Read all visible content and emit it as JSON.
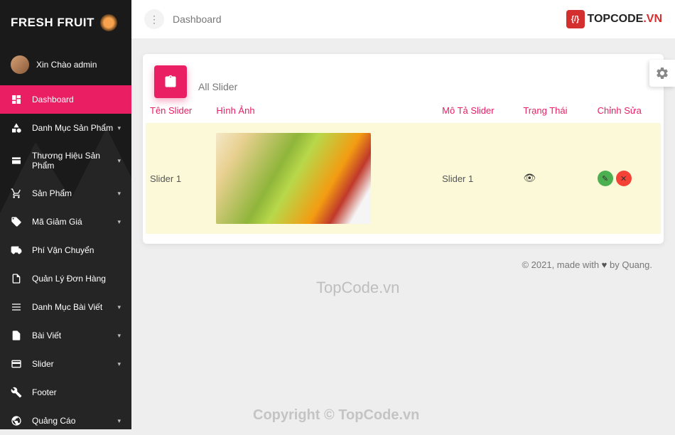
{
  "brand": {
    "name": "FRESH FRUIT",
    "watermark_site": "TOPCODE",
    "watermark_tld": ".VN"
  },
  "user": {
    "greeting": "Xin Chào admin"
  },
  "nav": [
    {
      "label": "Dashboard",
      "icon": "dashboard",
      "active": true,
      "caret": false
    },
    {
      "label": "Danh Mục Sản Phẩm",
      "icon": "category",
      "active": false,
      "caret": true
    },
    {
      "label": "Thương Hiệu Sản Phẩm",
      "icon": "brand",
      "active": false,
      "caret": true
    },
    {
      "label": "Sản Phẩm",
      "icon": "cart",
      "active": false,
      "caret": true
    },
    {
      "label": "Mã Giảm Giá",
      "icon": "tag",
      "active": false,
      "caret": true
    },
    {
      "label": "Phí Vận Chuyển",
      "icon": "truck",
      "active": false,
      "caret": false
    },
    {
      "label": "Quản Lý Đơn Hàng",
      "icon": "order",
      "active": false,
      "caret": false
    },
    {
      "label": "Danh Mục Bài Viết",
      "icon": "list",
      "active": false,
      "caret": true
    },
    {
      "label": "Bài Viết",
      "icon": "post",
      "active": false,
      "caret": true
    },
    {
      "label": "Slider",
      "icon": "card",
      "active": false,
      "caret": true
    },
    {
      "label": "Footer",
      "icon": "wrench",
      "active": false,
      "caret": false
    },
    {
      "label": "Quảng Cáo",
      "icon": "ad",
      "active": false,
      "caret": true
    }
  ],
  "breadcrumb": "Dashboard",
  "card": {
    "title": "All Slider",
    "headers": {
      "name": "Tên Slider",
      "image": "Hình Ảnh",
      "desc": "Mô Tả Slider",
      "status": "Trạng Thái",
      "edit": "Chỉnh Sửa"
    },
    "rows": [
      {
        "name": "Slider 1",
        "desc": "Slider 1"
      }
    ]
  },
  "footer": {
    "prefix": "© 2021, made with ",
    "suffix": " by Quang."
  },
  "watermark1": "TopCode.vn",
  "watermark2": "Copyright © TopCode.vn"
}
